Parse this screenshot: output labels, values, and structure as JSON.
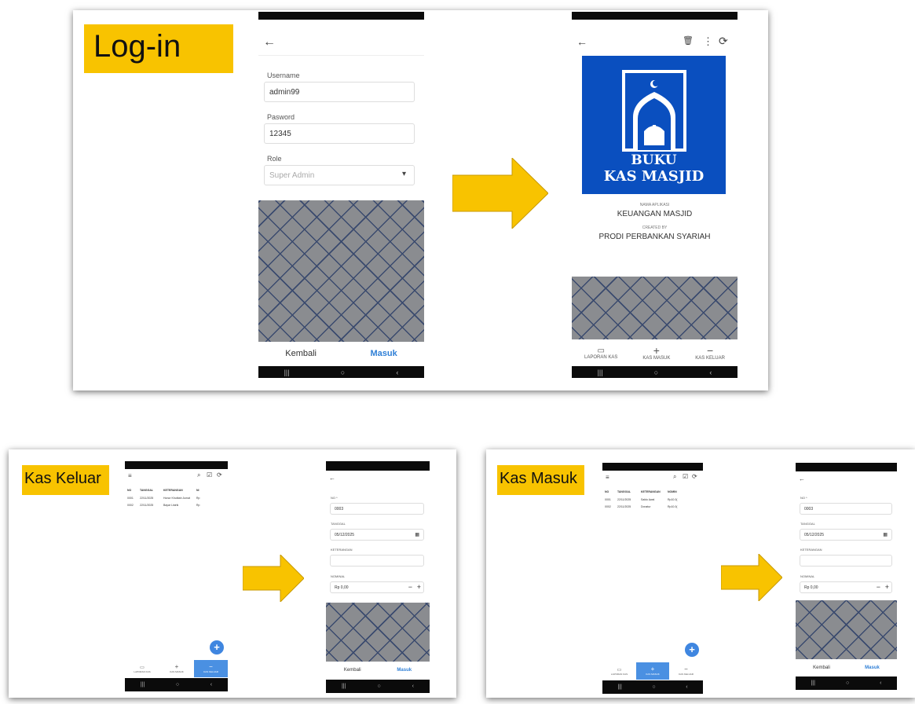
{
  "login_slide": {
    "title": "Log-in",
    "form": {
      "username_label": "Username",
      "username_value": "admin99",
      "password_label": "Pasword",
      "password_value": "12345",
      "role_label": "Role",
      "role_value": "Super Admin"
    },
    "actions": {
      "back": "Kembali",
      "submit": "Masuk"
    },
    "splash": {
      "logo_line1": "BUKU",
      "logo_line2": "KAS MASJID",
      "app_name_label": "NAMA APLIKASI",
      "app_name": "KEUANGAN MASJID",
      "created_by_label": "CREATED BY",
      "created_by": "PRODI PERBANKAN SYARIAH"
    },
    "tabs": [
      "LAPORAN KAS",
      "KAS MASUK",
      "KAS KELUAR"
    ]
  },
  "kas_keluar_slide": {
    "title": "Kas Keluar",
    "table": {
      "headers": [
        "NO",
        "TANGGAL",
        "KETERANGAN",
        "NI"
      ],
      "rows": [
        [
          "0001",
          "22/11/2025",
          "Honor Khutbah Jumat",
          "Rp"
        ],
        [
          "0002",
          "22/11/2025",
          "Bayar Listrik",
          "Rp"
        ]
      ]
    },
    "tabs": [
      "LAPORAN KAS",
      "KAS MASUK",
      "KAS KELUAR"
    ],
    "form": {
      "no_label": "NO *",
      "no_value": "0003",
      "tanggal_label": "TANGGAL",
      "tanggal_value": "05/12/2025",
      "keterangan_label": "KETERANGAN",
      "nominal_label": "NOMINAL",
      "nominal_value": "Rp 0,00"
    },
    "actions": {
      "back": "Kembali",
      "submit": "Masuk"
    }
  },
  "kas_masuk_slide": {
    "title": "Kas Masuk",
    "table": {
      "headers": [
        "NO",
        "TANGGAL",
        "KETERANGAN",
        "NOMIN"
      ],
      "rows": [
        [
          "0001",
          "22/11/2025",
          "Saldo Awal",
          "Rp10.0("
        ],
        [
          "0002",
          "22/11/2025",
          "Donatur",
          "Rp10.0("
        ]
      ]
    },
    "tabs": [
      "LAPORAN KAS",
      "KAS MASUK",
      "KAS KELUAR"
    ],
    "form": {
      "no_label": "NO *",
      "no_value": "0003",
      "tanggal_label": "TANGGAL",
      "tanggal_value": "05/12/2025",
      "keterangan_label": "KETERANGAN",
      "nominal_label": "NOMINAL",
      "nominal_value": "Rp 0,00"
    },
    "actions": {
      "back": "Kembali",
      "submit": "Masuk"
    }
  },
  "icons": {
    "back": "←",
    "trash": "🗑",
    "more": "⋮",
    "refresh": "⟳",
    "dropdown": "▾",
    "calendar": "▦",
    "plus": "+",
    "minus": "−",
    "menu": "≡",
    "search": "⌕",
    "checklist": "☑"
  },
  "colors": {
    "accent": "#f8c300",
    "brand_blue": "#0a4fbf",
    "link_blue": "#3f86e0"
  }
}
